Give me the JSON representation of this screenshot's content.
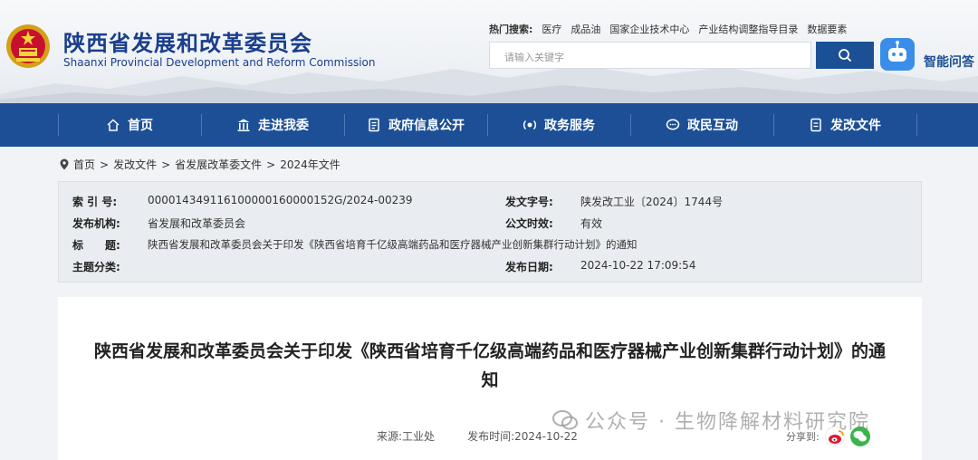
{
  "header": {
    "site_title": "陕西省发展和改革委员会",
    "site_subtitle": "Shaanxi Provincial Development and Reform Commission",
    "hot_label": "热门搜索:",
    "hot_links": [
      "医疗",
      "成品油",
      "国家企业技术中心",
      "产业结构调整指导目录",
      "数据要素"
    ],
    "search_placeholder": "请输入关键字",
    "ai_label": "智能问答"
  },
  "nav": {
    "items": [
      {
        "label": "首页",
        "icon": "home-icon"
      },
      {
        "label": "走进我委",
        "icon": "building-icon"
      },
      {
        "label": "政府信息公开",
        "icon": "document-icon"
      },
      {
        "label": "政务服务",
        "icon": "service-icon"
      },
      {
        "label": "政民互动",
        "icon": "chat-icon"
      },
      {
        "label": "发改文件",
        "icon": "file-icon"
      }
    ]
  },
  "breadcrumb": {
    "items": [
      "首页",
      "发改文件",
      "省发展改革委文件",
      "2024年文件"
    ],
    "separator": ">"
  },
  "meta": {
    "index_label": "索 引 号:",
    "index_value": "000014349116100000160000152G/2024-00239",
    "docno_label": "发文字号:",
    "docno_value": "陕发改工业〔2024〕1744号",
    "org_label": "发布机构:",
    "org_value": "省发展和改革委员会",
    "validity_label": "公文时效:",
    "validity_value": "有效",
    "title_label": "标　　题:",
    "title_value": "陕西省发展和改革委员会关于印发《陕西省培育千亿级高端药品和医疗器械产业创新集群行动计划》的通知",
    "topic_label": "主题分类:",
    "topic_value": "",
    "date_label": "发布日期:",
    "date_value": "2024-10-22 17:09:54"
  },
  "article": {
    "title": "陕西省发展和改革委员会关于印发《陕西省培育千亿级高端药品和医疗器械产业创新集群行动计划》的通知",
    "source_label": "来源:",
    "source_value": "工业处",
    "time_label": "发布时间:",
    "time_value": "2024-10-22",
    "share_label": "分享到:"
  },
  "watermark": {
    "text": "公众号 · 生物降解材料研究院"
  },
  "colors": {
    "brand_blue": "#1c4f96",
    "title_blue": "#1a3e8c",
    "weibo_red": "#e6162d",
    "wechat_green": "#3bb44a"
  }
}
